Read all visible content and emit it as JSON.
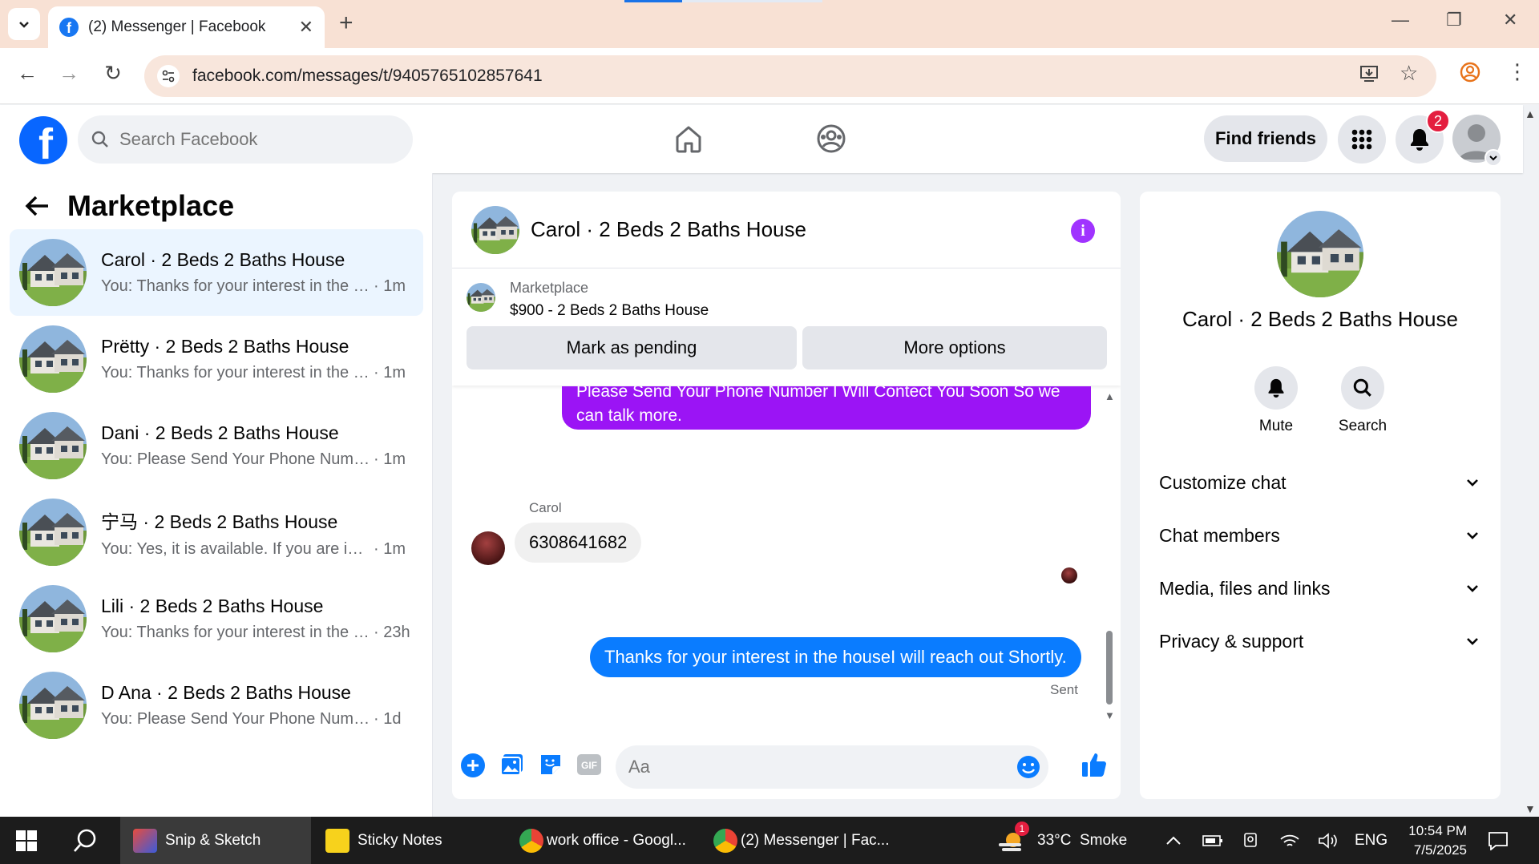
{
  "browser": {
    "tab_title": "(2) Messenger | Facebook",
    "url": "facebook.com/messages/t/9405765102857641"
  },
  "fb": {
    "search_placeholder": "Search Facebook",
    "find_friends": "Find friends",
    "notifications_count": "2"
  },
  "left": {
    "title": "Marketplace",
    "conversations": [
      {
        "name": "Carol · 2 Beds 2 Baths House",
        "preview": "You: Thanks for your interest in the h...",
        "time": "· 1m",
        "active": true
      },
      {
        "name": "Prëtty · 2 Beds 2 Baths House",
        "preview": "You: Thanks for your interest in the h...",
        "time": "· 1m"
      },
      {
        "name": "Dani · 2 Beds 2 Baths House",
        "preview": "You: Please Send Your Phone Numbe...",
        "time": "· 1m"
      },
      {
        "name": "宁马 · 2 Beds 2 Baths House",
        "preview": "You: Yes, it is available. If you are inte...",
        "time": "· 1m"
      },
      {
        "name": "Lili · 2 Beds 2 Baths House",
        "preview": "You: Thanks for your interest in the h...",
        "time": "· 23h"
      },
      {
        "name": "D Ana · 2 Beds 2 Baths House",
        "preview": "You: Please Send Your Phone Number...",
        "time": "· 1d"
      }
    ]
  },
  "chat": {
    "title": "Carol · 2 Beds 2 Baths House",
    "marketplace_label": "Marketplace",
    "listing": "$900 - 2 Beds 2 Baths House",
    "mark_pending": "Mark as pending",
    "more_options": "More options",
    "msg_out_1": "Please Send Your Phone Number I Will Contect You Soon So we can talk more.",
    "sender_name": "Carol",
    "msg_in_1": "6308641682",
    "msg_out_2": "Thanks for your interest in the houseI will reach out Shortly.",
    "status": "Sent",
    "composer_placeholder": "Aa"
  },
  "right": {
    "name": "Carol · 2 Beds 2 Baths House",
    "mute": "Mute",
    "search": "Search",
    "sections": [
      "Customize chat",
      "Chat members",
      "Media, files and links",
      "Privacy & support"
    ]
  },
  "taskbar": {
    "apps": [
      "Snip & Sketch",
      "Sticky Notes",
      "work office - Googl...",
      "(2) Messenger | Fac..."
    ],
    "weather": "33°C  Smoke",
    "weather_badge": "1",
    "lang": "ENG",
    "time": "10:54 PM",
    "date": "7/5/2025"
  },
  "colors": {
    "fb_blue": "#0866ff",
    "out_bubble": "#0a7cff",
    "purple_bubble": "#9b14f5",
    "active_conv": "#ebf5ff"
  }
}
